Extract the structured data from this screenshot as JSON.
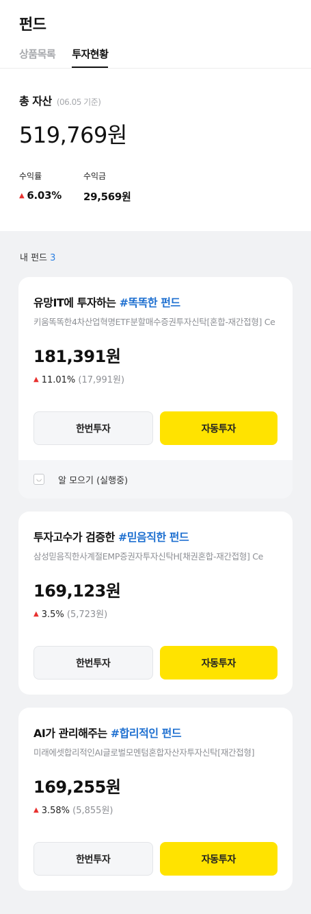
{
  "header": {
    "title": "펀드"
  },
  "tabs": [
    {
      "label": "상품목록"
    },
    {
      "label": "투자현황"
    }
  ],
  "summary": {
    "asset_label": "총 자산",
    "asset_date": "(06.05 기준)",
    "asset_amount": "519,769원",
    "return_rate_label": "수익률",
    "return_rate_value": "6.03%",
    "profit_label": "수익금",
    "profit_value": "29,569원"
  },
  "my_funds": {
    "label": "내 펀드",
    "count": "3"
  },
  "funds": [
    {
      "title_prefix": "유망IT에 투자하는 ",
      "title_highlight": "#똑똑한 펀드",
      "product_name": "키움똑똑한4차산업혁명ETF분할매수증권투자신탁[혼합-재간접형] Ce",
      "amount": "181,391원",
      "return_pct": "11.01%",
      "return_amount": "(17,991원)",
      "once_label": "한번투자",
      "auto_label": "자동투자",
      "footer_icon": "smile-icon",
      "footer_text": "알 모으기 (실행중)"
    },
    {
      "title_prefix": "투자고수가 검증한 ",
      "title_highlight": "#믿음직한 펀드",
      "product_name": "삼성믿음직한사계절EMP증권자투자신탁H[채권혼합-재간접형] Ce",
      "amount": "169,123원",
      "return_pct": "3.5%",
      "return_amount": "(5,723원)",
      "once_label": "한번투자",
      "auto_label": "자동투자"
    },
    {
      "title_prefix": "AI가 관리해주는 ",
      "title_highlight": "#합리적인 펀드",
      "product_name": "미래에셋합리적인AI글로벌모멘텀혼합자산자투자신탁[재간접형]",
      "amount": "169,255원",
      "return_pct": "3.58%",
      "return_amount": "(5,855원)",
      "once_label": "한번투자",
      "auto_label": "자동투자"
    }
  ],
  "colors": {
    "accent_yellow": "#ffe300",
    "up_red": "#e8312f",
    "highlight_blue": "#1d6fd0"
  }
}
